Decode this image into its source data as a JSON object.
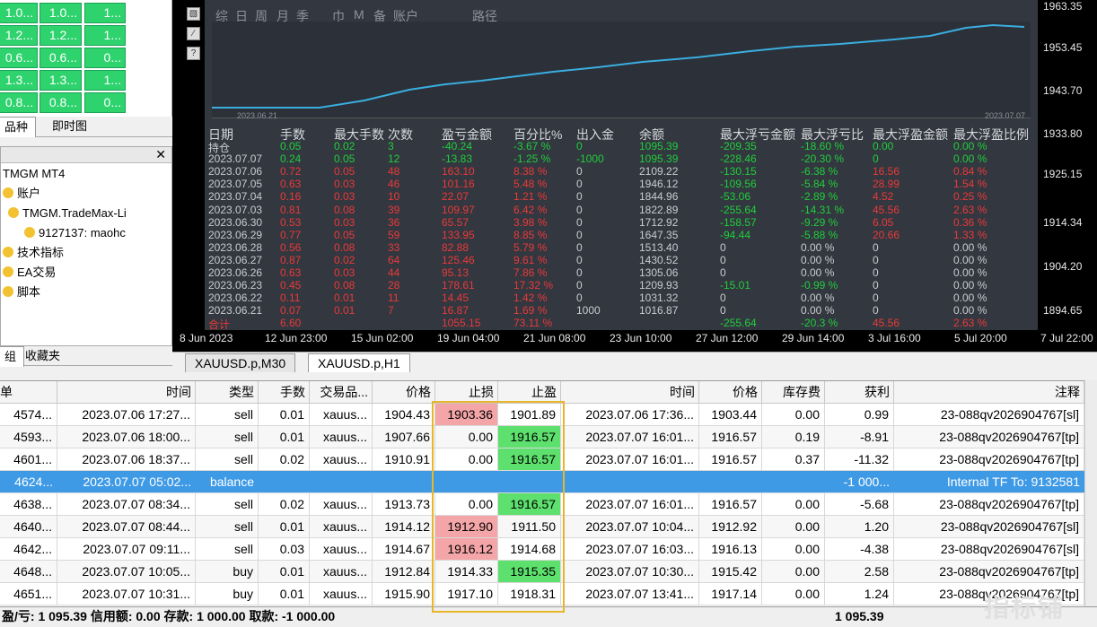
{
  "market_watch": {
    "rows": [
      [
        "1.0...",
        "1.0...",
        "1..."
      ],
      [
        "1.2...",
        "1.2...",
        "1..."
      ],
      [
        "0.6...",
        "0.6...",
        "0..."
      ],
      [
        "1.3...",
        "1.3...",
        "1..."
      ],
      [
        "0.8...",
        "0.8...",
        "0..."
      ]
    ],
    "tabs": [
      "品种",
      "即时图"
    ]
  },
  "navigator": {
    "items": [
      "TMGM MT4",
      "账户",
      "TMGM.TradeMax-Li",
      "9127137: maohc",
      "技术指标",
      "EA交易",
      "脚本"
    ],
    "tabs": [
      "组",
      "收藏夹"
    ]
  },
  "report": {
    "toolbar": [
      "综",
      "日",
      "周",
      "月",
      "季",
      "巾",
      "M",
      "备",
      "账户",
      "路径"
    ],
    "curve_dates": [
      "2023.06.21",
      "2023.07.07"
    ],
    "headers": [
      "日期",
      "手数",
      "最大手数",
      "次数",
      "盈亏金额",
      "百分比%",
      "出入金",
      "余额",
      "最大浮亏金额",
      "最大浮亏比",
      "最大浮盈金额",
      "最大浮盈比例"
    ],
    "rows": [
      [
        "持仓",
        "0.05",
        "0.02",
        "3",
        "-40.24",
        "-3.67 %",
        "0",
        "1095.39",
        "-209.35",
        "-18.60 %",
        "0.00",
        "0.00 %"
      ],
      [
        "2023.07.07",
        "0.24",
        "0.05",
        "12",
        "-13.83",
        "-1.25 %",
        "-1000",
        "1095.39",
        "-228.46",
        "-20.30 %",
        "0",
        "0.00 %"
      ],
      [
        "2023.07.06",
        "0.72",
        "0.05",
        "48",
        "163.10",
        "8.38 %",
        "0",
        "2109.22",
        "-130.15",
        "-6.38 %",
        "16.56",
        "0.84 %"
      ],
      [
        "2023.07.05",
        "0.63",
        "0.03",
        "46",
        "101.16",
        "5.48 %",
        "0",
        "1946.12",
        "-109.56",
        "-5.84 %",
        "28.99",
        "1.54 %"
      ],
      [
        "2023.07.04",
        "0.16",
        "0.03",
        "10",
        "22.07",
        "1.21 %",
        "0",
        "1844.96",
        "-53.06",
        "-2.89 %",
        "4.52",
        "0.25 %"
      ],
      [
        "2023.07.03",
        "0.81",
        "0.08",
        "39",
        "109.97",
        "6.42 %",
        "0",
        "1822.89",
        "-255.64",
        "-14.31 %",
        "45.56",
        "2.63 %"
      ],
      [
        "2023.06.30",
        "0.53",
        "0.03",
        "36",
        "65.57",
        "3.98 %",
        "0",
        "1712.92",
        "-158.57",
        "-9.29 %",
        "6.05",
        "0.36 %"
      ],
      [
        "2023.06.29",
        "0.77",
        "0.05",
        "59",
        "133.95",
        "8.85 %",
        "0",
        "1647.35",
        "-94.44",
        "-5.88 %",
        "20.66",
        "1.33 %"
      ],
      [
        "2023.06.28",
        "0.56",
        "0.08",
        "33",
        "82.88",
        "5.79 %",
        "0",
        "1513.40",
        "0",
        "0.00 %",
        "0",
        "0.00 %"
      ],
      [
        "2023.06.27",
        "0.87",
        "0.02",
        "64",
        "125.46",
        "9.61 %",
        "0",
        "1430.52",
        "0",
        "0.00 %",
        "0",
        "0.00 %"
      ],
      [
        "2023.06.26",
        "0.63",
        "0.03",
        "44",
        "95.13",
        "7.86 %",
        "0",
        "1305.06",
        "0",
        "0.00 %",
        "0",
        "0.00 %"
      ],
      [
        "2023.06.23",
        "0.45",
        "0.08",
        "28",
        "178.61",
        "17.32 %",
        "0",
        "1209.93",
        "-15.01",
        "-0.99 %",
        "0",
        "0.00 %"
      ],
      [
        "2023.06.22",
        "0.11",
        "0.01",
        "11",
        "14.45",
        "1.42 %",
        "0",
        "1031.32",
        "0",
        "0.00 %",
        "0",
        "0.00 %"
      ],
      [
        "2023.06.21",
        "0.07",
        "0.01",
        "7",
        "16.87",
        "1.69 %",
        "1000",
        "1016.87",
        "0",
        "0.00 %",
        "0",
        "0.00 %"
      ],
      [
        "合计",
        "6.60",
        "",
        "",
        "1055.15",
        "73.11 %",
        "",
        "",
        "-255.64",
        "-20.3 %",
        "45.56",
        "2.63 %"
      ]
    ]
  },
  "y_axis": [
    "1963.35",
    "1953.45",
    "1943.70",
    "1933.80",
    "1925.15",
    "1914.34",
    "1904.20",
    "1894.65"
  ],
  "x_axis": [
    "8 Jun 2023",
    "12 Jun 23:00",
    "15 Jun 02:00",
    "19 Jun 04:00",
    "21 Jun 08:00",
    "23 Jun 10:00",
    "27 Jun 12:00",
    "29 Jun 14:00",
    "3 Jul 16:00",
    "5 Jul 20:00",
    "7 Jul 22:00"
  ],
  "chart_tabs": [
    "XAUUSD.p,M30",
    "XAUUSD.p,H1"
  ],
  "trades": {
    "headers": [
      "单",
      "时间",
      "类型",
      "手数",
      "交易品...",
      "价格",
      "止损",
      "止盈",
      "时间",
      "价格",
      "库存费",
      "获利",
      "注释"
    ],
    "rows": [
      [
        "4574...",
        "2023.07.06 17:27...",
        "sell",
        "0.01",
        "xauus...",
        "1904.43",
        "1903.36",
        "1901.89",
        "2023.07.06 17:36...",
        "1903.44",
        "0.00",
        "0.99",
        "23-088qv2026904767[sl]"
      ],
      [
        "4593...",
        "2023.07.06 18:00...",
        "sell",
        "0.01",
        "xauus...",
        "1907.66",
        "0.00",
        "1916.57",
        "2023.07.07 16:01...",
        "1916.57",
        "0.19",
        "-8.91",
        "23-088qv2026904767[tp]"
      ],
      [
        "4601...",
        "2023.07.06 18:37...",
        "sell",
        "0.02",
        "xauus...",
        "1910.91",
        "0.00",
        "1916.57",
        "2023.07.07 16:01...",
        "1916.57",
        "0.37",
        "-11.32",
        "23-088qv2026904767[tp]"
      ],
      [
        "4624...",
        "2023.07.07 05:02...",
        "balance",
        "",
        "",
        "",
        "",
        "",
        "",
        "",
        "",
        "-1 000...",
        "Internal TF To: 9132581"
      ],
      [
        "4638...",
        "2023.07.07 08:34...",
        "sell",
        "0.02",
        "xauus...",
        "1913.73",
        "0.00",
        "1916.57",
        "2023.07.07 16:01...",
        "1916.57",
        "0.00",
        "-5.68",
        "23-088qv2026904767[tp]"
      ],
      [
        "4640...",
        "2023.07.07 08:44...",
        "sell",
        "0.01",
        "xauus...",
        "1914.12",
        "1912.90",
        "1911.50",
        "2023.07.07 10:04...",
        "1912.92",
        "0.00",
        "1.20",
        "23-088qv2026904767[sl]"
      ],
      [
        "4642...",
        "2023.07.07 09:11...",
        "sell",
        "0.03",
        "xauus...",
        "1914.67",
        "1916.12",
        "1914.68",
        "2023.07.07 16:03...",
        "1916.13",
        "0.00",
        "-4.38",
        "23-088qv2026904767[sl]"
      ],
      [
        "4648...",
        "2023.07.07 10:05...",
        "buy",
        "0.01",
        "xauus...",
        "1912.84",
        "1914.33",
        "1915.35",
        "2023.07.07 10:30...",
        "1915.42",
        "0.00",
        "2.58",
        "23-088qv2026904767[tp]"
      ],
      [
        "4651...",
        "2023.07.07 10:31...",
        "buy",
        "0.01",
        "xauus...",
        "1915.90",
        "1917.10",
        "1918.31",
        "2023.07.07 13:41...",
        "1917.14",
        "0.00",
        "1.24",
        "23-088qv2026904767[tp]"
      ]
    ],
    "cell_colors": {
      "0-6": "pink",
      "1-7": "green",
      "2-7": "green",
      "4-7": "green",
      "5-6": "pink",
      "6-6": "pink",
      "7-7": "green"
    }
  },
  "status": {
    "text": "盈/亏: 1 095.39  信用额: 0.00  存款: 1 000.00  取款: -1 000.00",
    "total": "1 095.39"
  },
  "watermark": "指标铺"
}
